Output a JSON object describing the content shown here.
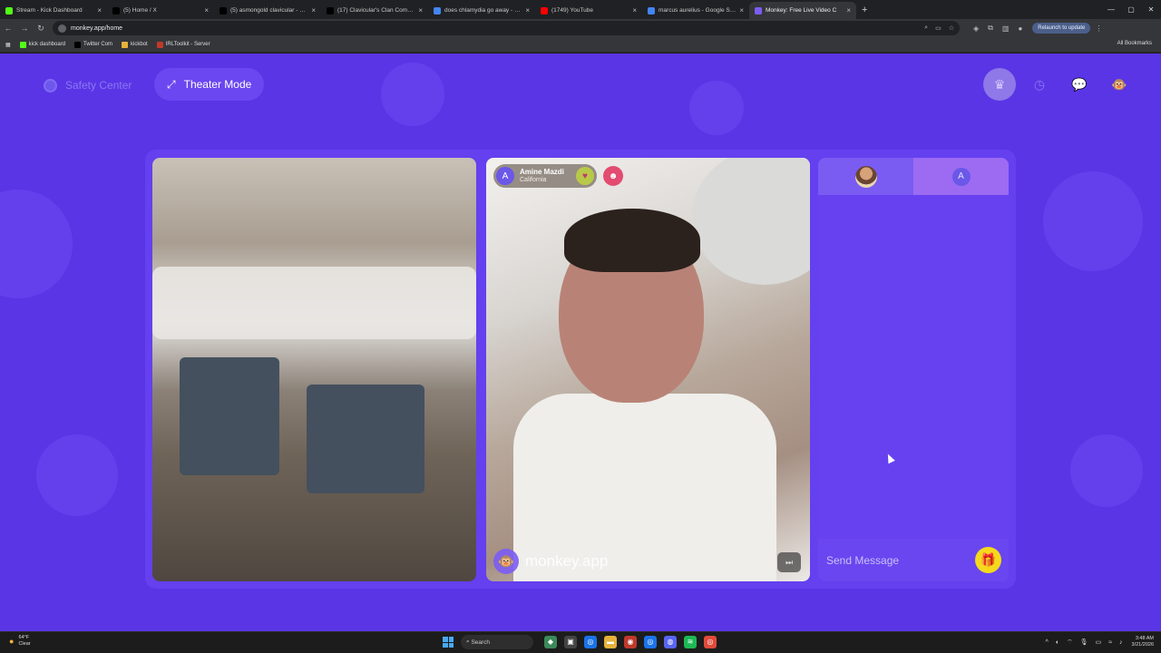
{
  "browser": {
    "tabs": [
      {
        "title": "Stream - Kick Dashboard",
        "icon": "kick-icon",
        "color": "#53fc18"
      },
      {
        "title": "(5) Home / X",
        "icon": "x-icon",
        "color": "#000000"
      },
      {
        "title": "(5) asmongold clavicular - Sear",
        "icon": "x-icon",
        "color": "#000000"
      },
      {
        "title": "(17) Clavicular's Clan Commun",
        "icon": "x-icon",
        "color": "#000000"
      },
      {
        "title": "does chlamydia go away - Goo",
        "icon": "google-icon",
        "color": "#4285f4"
      },
      {
        "title": "(1749) YouTube",
        "icon": "youtube-icon",
        "color": "#ff0000"
      },
      {
        "title": "marcus aurelius - Google Searc",
        "icon": "google-icon",
        "color": "#4285f4"
      },
      {
        "title": "Monkey: Free Live Video C",
        "icon": "monkey-icon",
        "color": "#7d5cf4"
      }
    ],
    "url": "monkey.app/home",
    "relaunch_label": "Relaunch to update",
    "bookmarks": [
      {
        "label": "kick dashboard",
        "icon": "kick-icon"
      },
      {
        "label": "Twitter Com",
        "icon": "x-icon"
      },
      {
        "label": "kickbot",
        "icon": "kickbot-icon"
      },
      {
        "label": "IRLToolkit - Server",
        "icon": "irltoolkit-icon"
      }
    ],
    "all_bookmarks_label": "All Bookmarks"
  },
  "page": {
    "safety_center_label": "Safety Center",
    "theater_mode_label": "Theater Mode",
    "nav": [
      "crown-icon",
      "history-icon",
      "chat-icon",
      "monkey-avatar-icon"
    ],
    "accent_color": "#5a35e6",
    "remote_user": {
      "avatar_letter": "A",
      "name": "Amine Mazdi",
      "location": "California"
    },
    "watermark": "monkey.app",
    "chat": {
      "avatar_letter": "A",
      "placeholder": "Send Message"
    }
  },
  "taskbar": {
    "weather_temp": "64°F",
    "weather_desc": "Clear",
    "search_label": "Search",
    "time": "3:48 AM",
    "date": "3/21/2026"
  }
}
